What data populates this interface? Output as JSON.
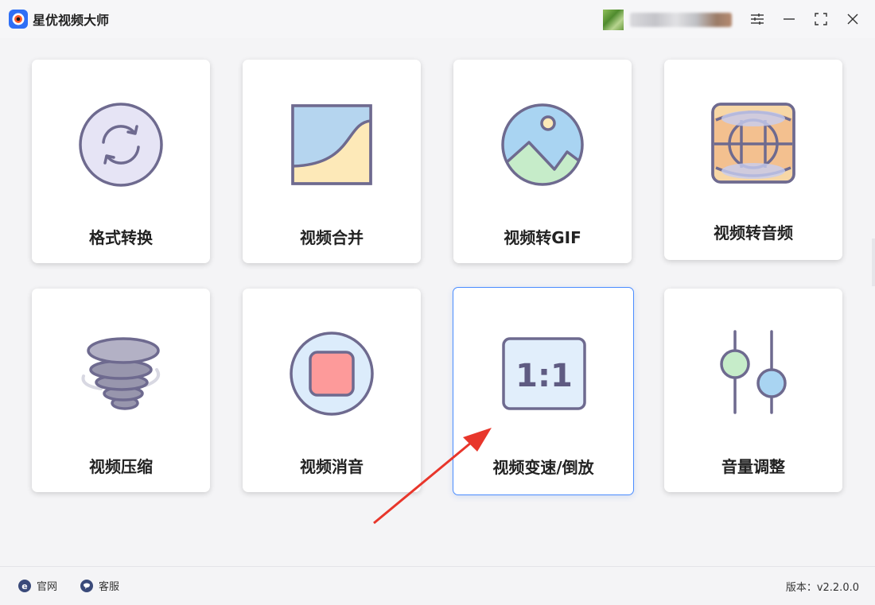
{
  "app": {
    "title": "星优视频大师"
  },
  "colors": {
    "accent": "#2f6ff5",
    "card_border_active": "#4a8cff",
    "icon_stroke": "#6e6a8f",
    "arrow": "#e8362b"
  },
  "tools": [
    {
      "label": "格式转换",
      "icon": "refresh-convert-icon"
    },
    {
      "label": "视频合并",
      "icon": "merge-curve-icon"
    },
    {
      "label": "视频转GIF",
      "icon": "image-landscape-icon"
    },
    {
      "label": "视频转音频",
      "icon": "panorama-audio-icon"
    },
    {
      "label": "视频压缩",
      "icon": "tornado-compress-icon"
    },
    {
      "label": "视频消音",
      "icon": "stop-square-icon"
    },
    {
      "label": "视频变速/倒放",
      "icon": "ratio-1-1-icon",
      "ratio_text": "1:1"
    },
    {
      "label": "音量调整",
      "icon": "volume-sliders-icon"
    }
  ],
  "footer": {
    "site_label": "官网",
    "service_label": "客服",
    "version_text": "版本：v2.2.0.0"
  }
}
